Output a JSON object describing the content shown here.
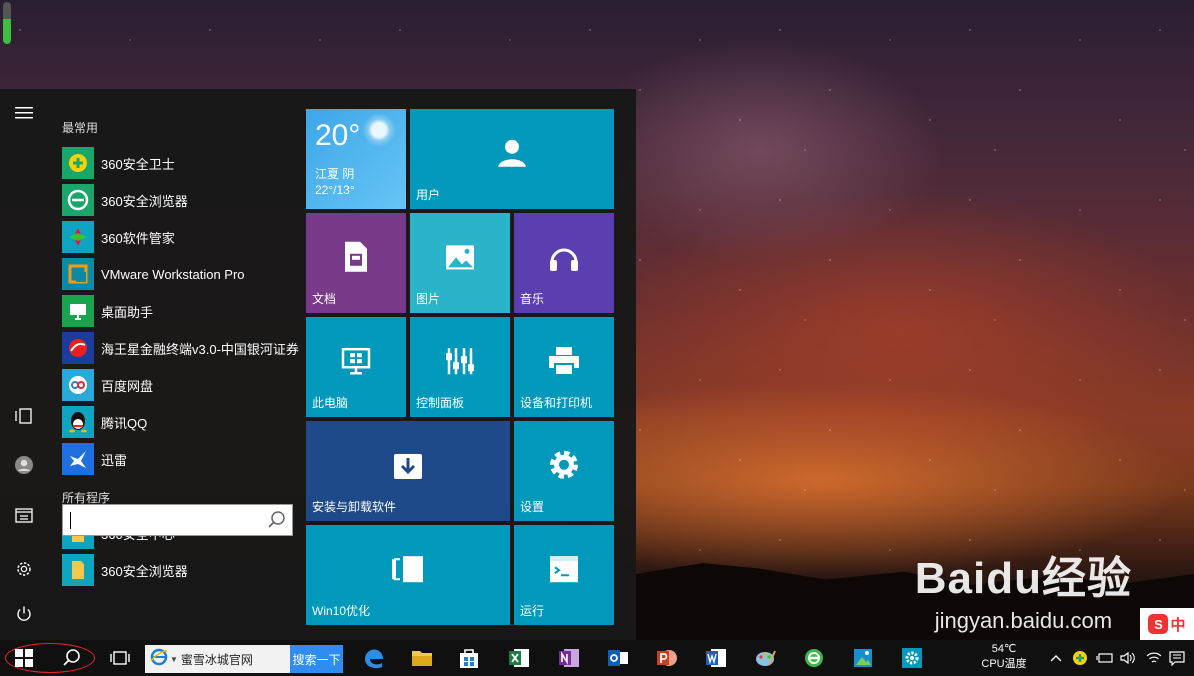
{
  "start_menu": {
    "most_used_label": "最常用",
    "all_programs_label": "所有程序",
    "most_used": [
      {
        "label": "360安全卫士",
        "icon": "360-safe-guard-icon"
      },
      {
        "label": "360安全浏览器",
        "icon": "360-browser-icon"
      },
      {
        "label": "360软件管家",
        "icon": "360-software-manager-icon"
      },
      {
        "label": "VMware Workstation Pro",
        "icon": "vmware-icon"
      },
      {
        "label": "桌面助手",
        "icon": "desktop-assistant-icon"
      },
      {
        "label": "海王星金融终端v3.0-中国银河证券",
        "icon": "neptune-finance-icon"
      },
      {
        "label": "百度网盘",
        "icon": "baidu-netdisk-icon"
      },
      {
        "label": "腾讯QQ",
        "icon": "qq-icon"
      },
      {
        "label": "迅雷",
        "icon": "xunlei-icon"
      }
    ],
    "all_programs": [
      {
        "label": "360安全中心",
        "icon": "folder-icon"
      },
      {
        "label": "360安全浏览器",
        "icon": "folder-icon"
      }
    ],
    "tiles": {
      "weather": {
        "temp": "20°",
        "place": "江夏 阴",
        "range": "22°/13°"
      },
      "users": "用户",
      "documents": "文档",
      "pictures": "图片",
      "music": "音乐",
      "this_pc": "此电脑",
      "control_panel": "控制面板",
      "devices_printers": "设备和打印机",
      "install_uninstall": "安装与卸载软件",
      "settings": "设置",
      "win10_optimize": "Win10优化",
      "run": "运行"
    },
    "colors": {
      "tile_teal": "#0099bc",
      "tile_purple": "#7a3a8a",
      "tile_light_teal": "#2ab3c9",
      "tile_violet": "#5b3fb0",
      "tile_navy": "#1f4a8a",
      "weather_blue": "#3ea6e8"
    }
  },
  "taskbar": {
    "bookmark_text": "蜜雪冰城官网",
    "search_button": "搜索一下",
    "cpu_temp": "54℃",
    "cpu_label": "CPU温度",
    "ime_label": "中"
  },
  "watermark": {
    "brand": "Baidu经验",
    "url": "jingyan.baidu.com"
  }
}
